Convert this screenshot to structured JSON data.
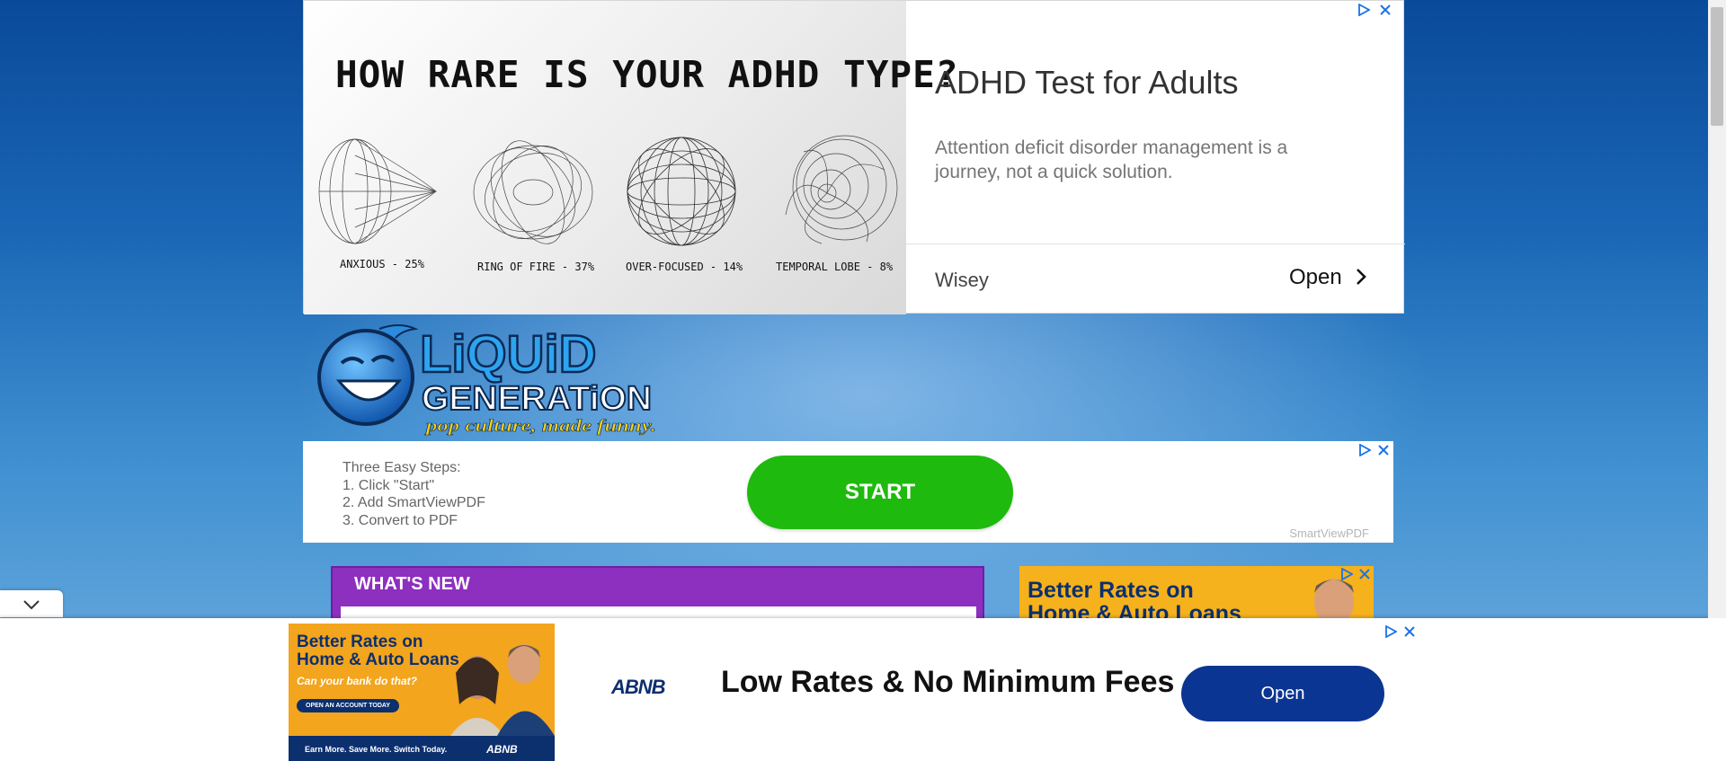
{
  "top_ad": {
    "headline": "HOW RARE IS YOUR ADHD TYPE?",
    "shapes": [
      {
        "label": "ANXIOUS - 25%",
        "icon": "cone-wireframe-icon"
      },
      {
        "label": "RING OF FIRE - 37%",
        "icon": "torus-wireframe-icon"
      },
      {
        "label": "OVER-FOCUSED - 14%",
        "icon": "sphere-wireframe-icon"
      },
      {
        "label": "TEMPORAL LOBE - 8%",
        "icon": "shell-wireframe-icon"
      }
    ],
    "title": "ADHD Test for Adults",
    "description": "Attention deficit disorder management is a journey, not a quick solution.",
    "advertiser": "Wisey",
    "open_label": "Open"
  },
  "logo": {
    "line1": "LiQUiD",
    "line2": "GENERATiON",
    "tagline": "pop culture, made funny."
  },
  "mid_ad": {
    "steps_title": "Three Easy Steps:",
    "steps": [
      "1. Click \"Start\"",
      "2. Add SmartViewPDF",
      "3. Convert to PDF"
    ],
    "start_label": "START",
    "sponsor": "SmartViewPDF"
  },
  "whats_new": {
    "label": "WHAT'S NEW"
  },
  "side_ad": {
    "line1": "Better Rates on",
    "line2": "Home & Auto Loans"
  },
  "anchor_ad": {
    "creative_line1": "Better Rates on",
    "creative_line2": "Home & Auto Loans",
    "creative_sub": "Can your bank do that?",
    "creative_button": "OPEN AN ACCOUNT TODAY",
    "creative_tagline": "Earn More. Save More. Switch Today.",
    "creative_logo": "ABNB",
    "bank_logo": "ABNB",
    "headline": "Low Rates & No Minimum Fees",
    "open_label": "Open"
  },
  "colors": {
    "start_green": "#1fba0e",
    "purple": "#8d2fbf",
    "navy": "#0c2f6e",
    "orange": "#f5b21c",
    "ad_blue": "#1a73e8"
  }
}
